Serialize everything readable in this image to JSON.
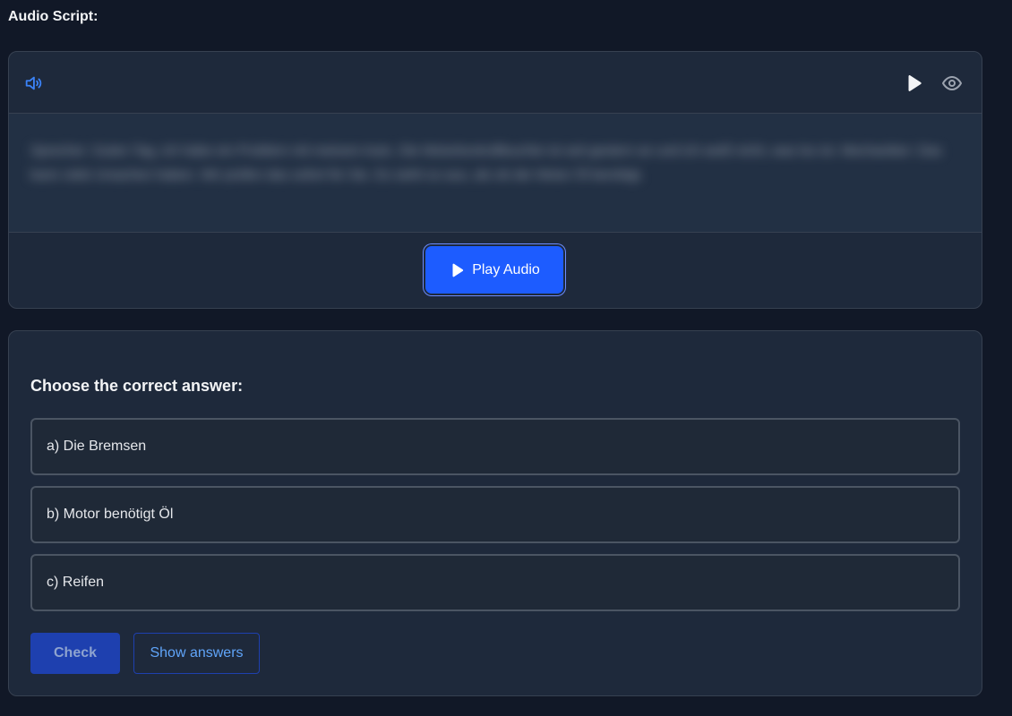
{
  "audio_script": {
    "label": "Audio Script:",
    "hidden_text": "Sprecher: Guten Tag, ich habe ein Problem mit meinem Auto. Die Motorkontrollleuchte ist seit gestern an und ich weiß nicht, was los ist. Mechaniker: Das kann viele Ursachen haben. Wir prüfen das sofort für Sie. Es sieht so aus, als ob der Motor Öl benötigt.",
    "play_label": "Play Audio",
    "icons": {
      "speaker": "speaker-icon",
      "play": "play-icon",
      "reveal": "eye-icon"
    },
    "accent_color": "#1d5cff"
  },
  "question": {
    "title": "Choose the correct answer:",
    "options": [
      {
        "label": "a) Die Bremsen"
      },
      {
        "label": "b) Motor benötigt Öl"
      },
      {
        "label": "c) Reifen"
      }
    ],
    "check_label": "Check",
    "show_answers_label": "Show answers"
  }
}
